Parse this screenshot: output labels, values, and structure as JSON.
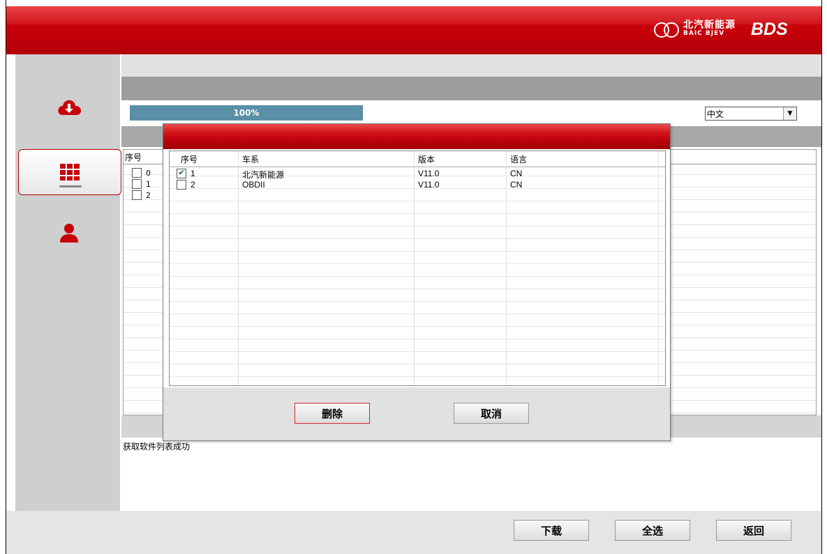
{
  "header": {
    "logo_cn": "北汽新能源",
    "logo_en": "BAIC BJEV",
    "product": "BDS"
  },
  "sidebar": {
    "items": [
      {
        "name": "download",
        "icon": "cloud-download-icon"
      },
      {
        "name": "apps",
        "icon": "grid-icon",
        "active": true
      },
      {
        "name": "user",
        "icon": "user-icon"
      }
    ]
  },
  "main": {
    "progress_text": "100%",
    "progress": 1.0,
    "language_value": "中文",
    "table_header": "序号",
    "rows": [
      "0",
      "1",
      "2"
    ],
    "status": "获取软件列表成功"
  },
  "footer": {
    "download_label": "下载",
    "select_all_label": "全选",
    "back_label": "返回"
  },
  "dialog": {
    "columns": [
      "序号",
      "车系",
      "版本",
      "语言"
    ],
    "rows": [
      {
        "index": "1",
        "series": "北汽新能源",
        "version": "V11.0",
        "lang": "CN",
        "checked": true
      },
      {
        "index": "2",
        "series": "OBDII",
        "version": "V11.0",
        "lang": "CN",
        "checked": false
      }
    ],
    "delete_label": "删除",
    "cancel_label": "取消"
  },
  "colors": {
    "brand_red": "#c8000a",
    "progress": "#5a8fa8",
    "sidebar": "#cfcfcf"
  }
}
